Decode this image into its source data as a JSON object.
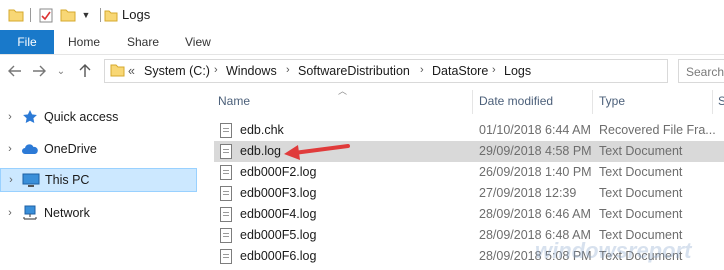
{
  "title": "Logs",
  "ribbon": {
    "file": "File",
    "tabs": [
      "Home",
      "Share",
      "View"
    ]
  },
  "address": {
    "prefix": "«",
    "crumbs": [
      "System (C:)",
      "Windows",
      "SoftwareDistribution",
      "DataStore",
      "Logs"
    ]
  },
  "search": {
    "placeholder": "Search"
  },
  "nav": {
    "items": [
      {
        "label": "Quick access",
        "icon": "star-icon"
      },
      {
        "label": "OneDrive",
        "icon": "cloud-icon"
      },
      {
        "label": "This PC",
        "icon": "computer-icon"
      },
      {
        "label": "Network",
        "icon": "network-icon"
      }
    ]
  },
  "columns": {
    "name": "Name",
    "date": "Date modified",
    "type": "Type",
    "size": "S"
  },
  "files": [
    {
      "name": "edb.chk",
      "date": "01/10/2018 6:44 AM",
      "type": "Recovered File Fra..."
    },
    {
      "name": "edb.log",
      "date": "29/09/2018 4:58 PM",
      "type": "Text Document"
    },
    {
      "name": "edb000F2.log",
      "date": "26/09/2018 1:40 PM",
      "type": "Text Document"
    },
    {
      "name": "edb000F3.log",
      "date": "27/09/2018 12:39",
      "type": "Text Document"
    },
    {
      "name": "edb000F4.log",
      "date": "28/09/2018 6:46 AM",
      "type": "Text Document"
    },
    {
      "name": "edb000F5.log",
      "date": "28/09/2018 6:48 AM",
      "type": "Text Document"
    },
    {
      "name": "edb000F6.log",
      "date": "28/09/2018 5:08 PM",
      "type": "Text Document"
    }
  ],
  "watermark": "windowsreport",
  "colors": {
    "accent": "#1979ca",
    "annotation": "#e03b3b",
    "selected_nav": "#cce8ff"
  }
}
